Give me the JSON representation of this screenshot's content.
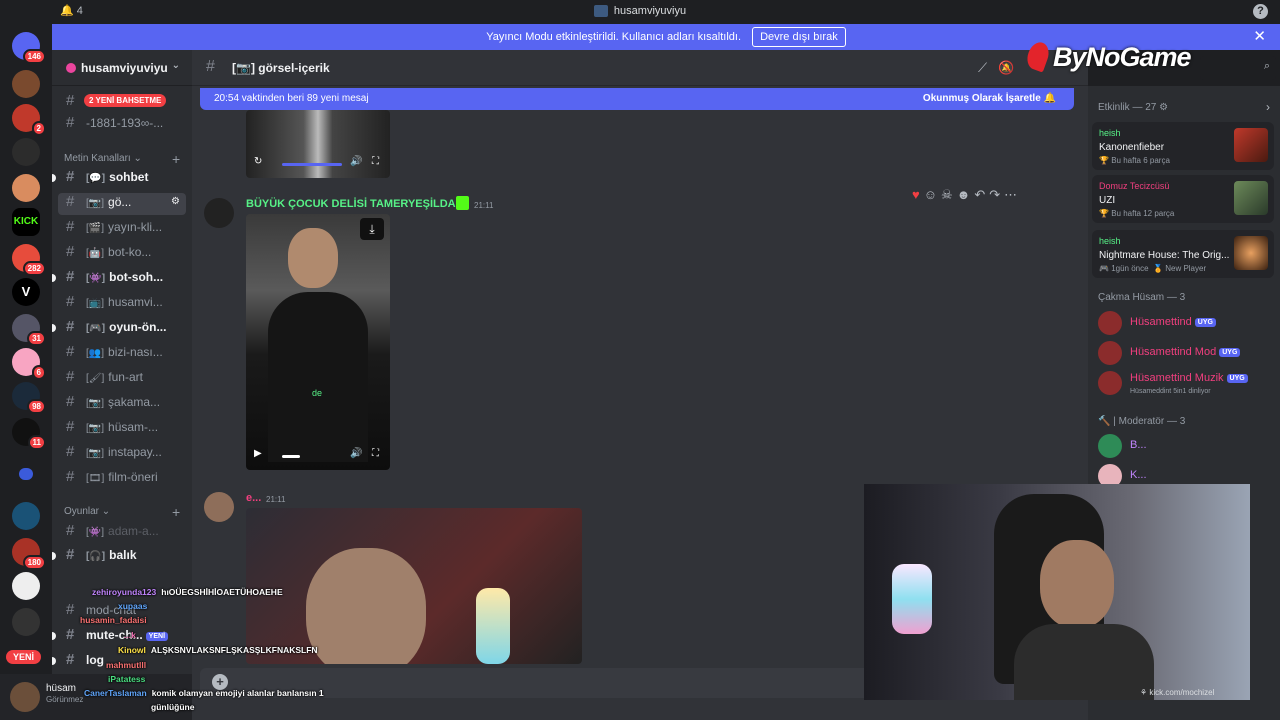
{
  "titlebar": {
    "notification_count": "4",
    "title": "husamviyuviyu",
    "help": "?"
  },
  "notice": {
    "text": "Yayıncı Modu etkinleştirildi. Kullanıcı adları kısaltıldı.",
    "button": "Devre dışı bırak"
  },
  "brand": {
    "name": "ByNoGame"
  },
  "rail": {
    "badges": [
      "146",
      "2",
      "282",
      "31",
      "6",
      "98",
      "11",
      "180"
    ],
    "kick": "KICK",
    "new_label": "YENİ"
  },
  "server": {
    "name": "husamviyuviyu"
  },
  "sidebar": {
    "mention_pill": "2 YENİ BAHSETME",
    "top_channel": "-1881-193∞-...",
    "category_metin": "Metin Kanalları",
    "category_oyunlar": "Oyunlar",
    "channels": [
      {
        "label": "sohbet",
        "emoji": "💬"
      },
      {
        "label": "gö...",
        "emoji": "📷"
      },
      {
        "label": "yayın-kli...",
        "emoji": "🎬"
      },
      {
        "label": "bot-ko...",
        "emoji": "🤖"
      },
      {
        "label": "bot-soh...",
        "emoji": "👾"
      },
      {
        "label": "husamvi...",
        "emoji": "📺"
      },
      {
        "label": "oyun-ön...",
        "emoji": "🎮"
      },
      {
        "label": "bizi-nası...",
        "emoji": "👥"
      },
      {
        "label": "fun-art",
        "emoji": "🖌"
      },
      {
        "label": "şakama...",
        "emoji": "📷"
      },
      {
        "label": "hüsam-...",
        "emoji": "📷"
      },
      {
        "label": "instapay...",
        "emoji": "📷"
      },
      {
        "label": "film-öneri",
        "emoji": "🎞"
      }
    ],
    "games_channels": [
      {
        "label": "adam-a...",
        "emoji": "👾"
      },
      {
        "label": "balık",
        "emoji": "🎧"
      },
      {
        "label": "mod-chat",
        "emoji": ""
      },
      {
        "label": "mute-ch...",
        "emoji": ""
      },
      {
        "label": "log",
        "emoji": ""
      }
    ],
    "new_tag": "YENİ"
  },
  "user": {
    "name": "hüsam",
    "status": "Görünmez"
  },
  "channel": {
    "title": "[📷] görsel-içerik"
  },
  "newbar": {
    "text": "20:54 vaktinden beri 89 yeni mesaj",
    "mark": "Okunmuş Olarak İşaretle"
  },
  "messages": [
    {
      "author": "BÜYÜK ÇOCUK DELİSİ TAMERYEŞİLDAĞ",
      "time": "21:11",
      "caption": "de"
    },
    {
      "author": "e...",
      "time": "21:11"
    }
  ],
  "members": {
    "activity_header": "Etkinlik — 27",
    "activities": [
      {
        "who": "heish",
        "game": "Kanonenfieber",
        "meta": "Bu hafta 6 parça"
      },
      {
        "who": "Domuz Tecizcüsü",
        "game": "UZI",
        "meta": "Bu hafta 12 parça"
      },
      {
        "who": "heish",
        "game": "Nightmare House: The Orig...",
        "meta": "1gün önce",
        "meta2": "New Player"
      }
    ],
    "group1": "Çakma Hüsam — 3",
    "group1_members": [
      {
        "name": "Hüsamettind",
        "tag": "UYG",
        "sub": ""
      },
      {
        "name": "Hüsamettind Mod",
        "tag": "UYG",
        "sub": ""
      },
      {
        "name": "Hüsamettind Muzik",
        "tag": "UYG",
        "sub": "Hüsameddint 5in1 dinliyor"
      }
    ],
    "group2": "| Moderatör — 3",
    "group2_members": [
      {
        "name": "B...",
        "sub": ""
      },
      {
        "name": "K...",
        "sub": ""
      }
    ]
  },
  "webcam": {
    "credit": "kick.com/mochizel"
  },
  "stream_chat": [
    {
      "user": "zehiroyunda123",
      "text": "hıOÜEGSHİHİOAETÜHOAEHE",
      "color": "#c084fc"
    },
    {
      "user": "xupaas",
      "text": "",
      "color": "#60a5fa"
    },
    {
      "user": "husamin_fadaisi",
      "text": "",
      "color": "#f87171"
    },
    {
      "user": "...k",
      "text": "",
      "color": "#f472b6"
    },
    {
      "user": "Kinowl",
      "text": "ALŞKSNVLAKSNFLŞKASŞLKFNAKSLFN",
      "color": "#fde047"
    },
    {
      "user": "mahmutlll",
      "text": "",
      "color": "#f87171"
    },
    {
      "user": "iPatatess",
      "text": "",
      "color": "#4ade80"
    },
    {
      "user": "CanerTaslaman",
      "text": "komik olamyan emojiyi alanlar banlansın 1",
      "color": "#60a5fa"
    },
    {
      "user": "",
      "text": "günlüğüne",
      "color": "#ffffff"
    }
  ],
  "colors": {
    "accent": "#5865f2",
    "danger": "#f23f43",
    "kick_green": "#53fc18"
  }
}
